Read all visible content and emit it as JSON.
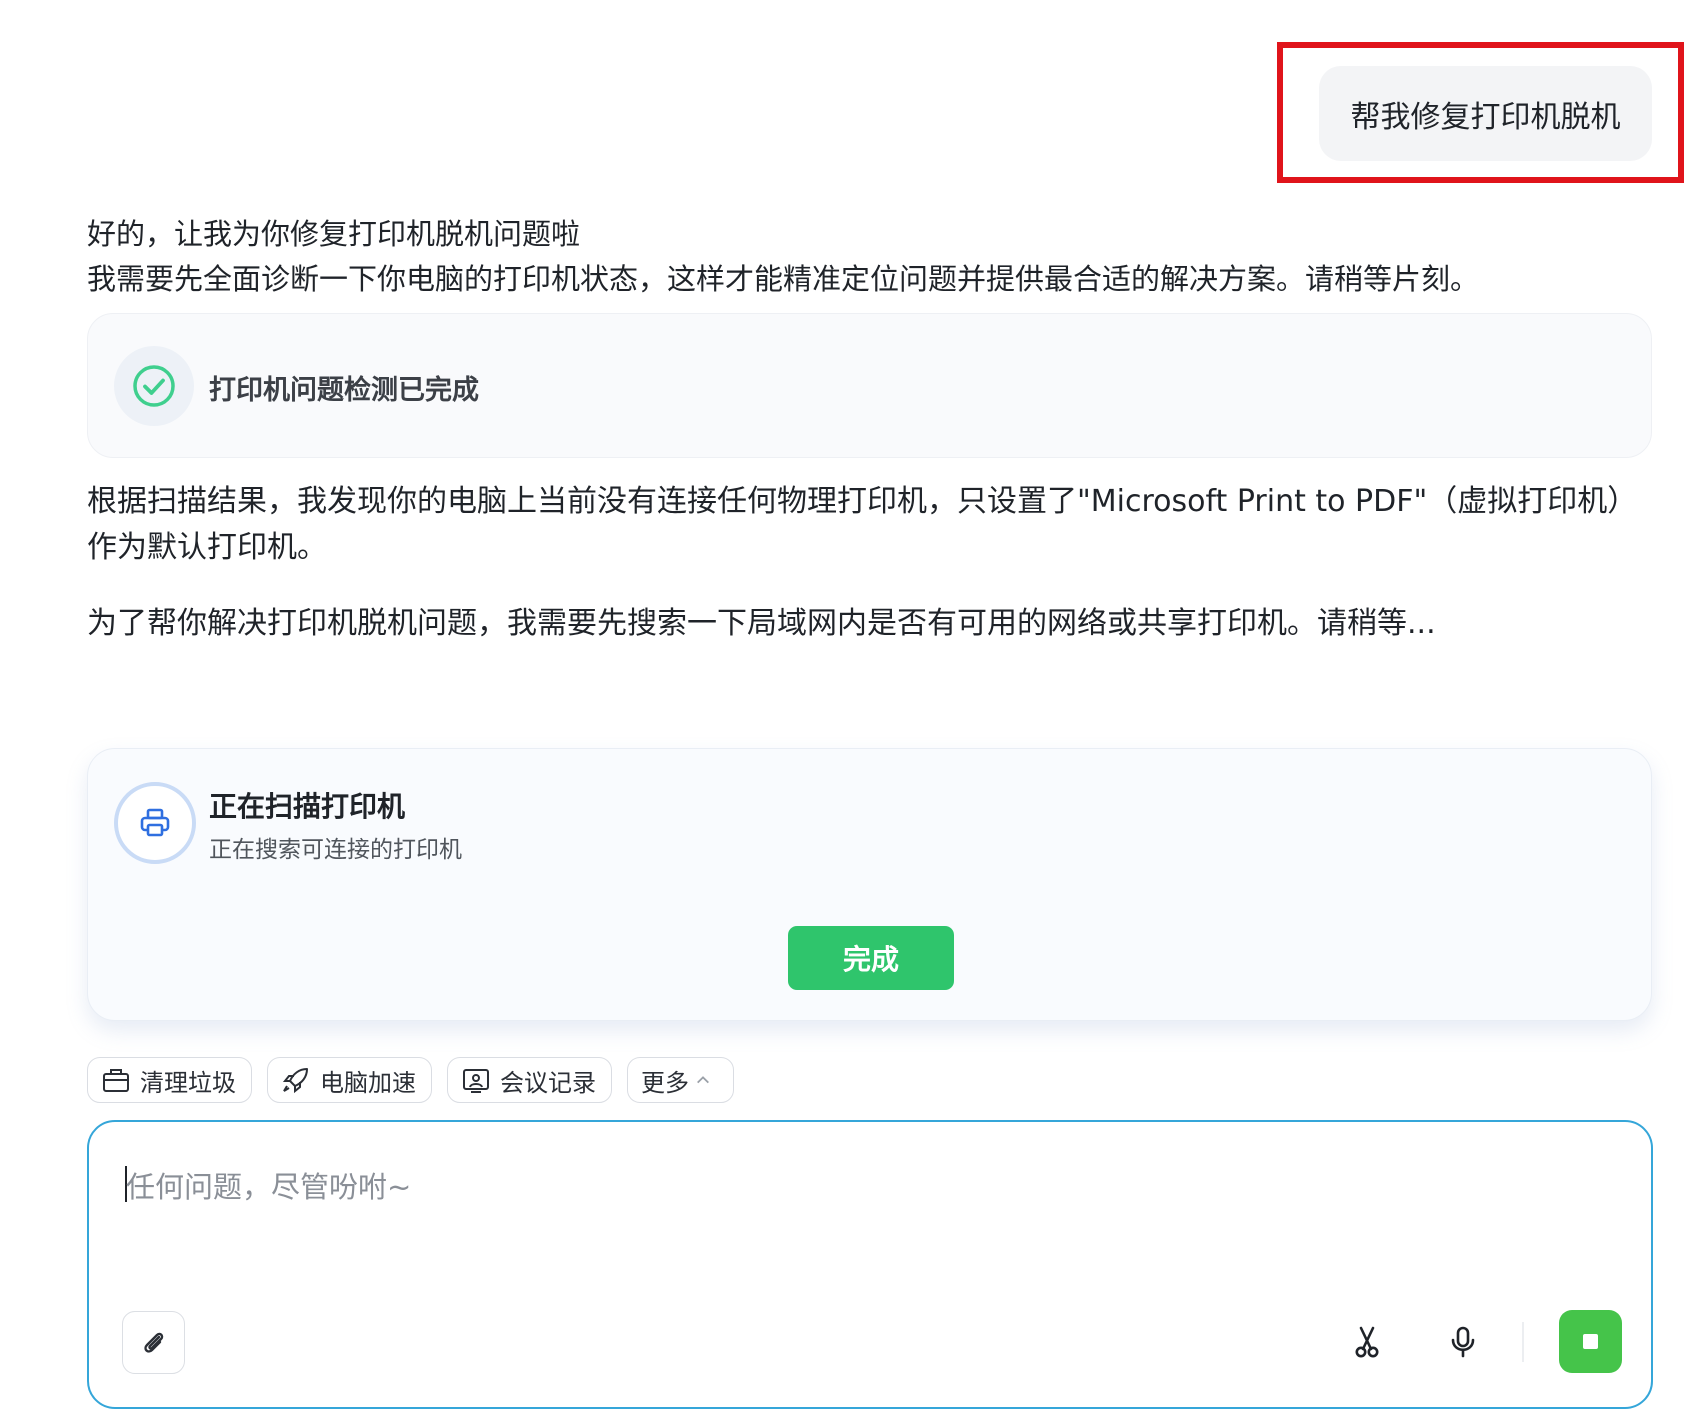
{
  "user_message": "帮我修复打印机脱机",
  "assistant": {
    "line1": "好的，让我为你修复打印机脱机问题啦",
    "line2": "我需要先全面诊断一下你电脑的打印机状态，这样才能精准定位问题并提供最合适的解决方案。请稍等片刻。",
    "detect_card_title": "打印机问题检测已完成",
    "result_para": "根据扫描结果，我发现你的电脑上当前没有连接任何物理打印机，只设置了\"Microsoft Print to PDF\"（虚拟打印机）作为默认打印机。",
    "next_para": "为了帮你解决打印机脱机问题，我需要先搜索一下局域网内是否有可用的网络或共享打印机。请稍等..."
  },
  "scan_card": {
    "title": "正在扫描打印机",
    "subtitle": "正在搜索可连接的打印机",
    "done_label": "完成"
  },
  "quick_actions": [
    {
      "label": "清理垃圾",
      "icon": "briefcase-icon"
    },
    {
      "label": "电脑加速",
      "icon": "rocket-icon"
    },
    {
      "label": "会议记录",
      "icon": "meeting-record-icon"
    },
    {
      "label": "更多",
      "icon": "chevron-up-icon"
    }
  ],
  "input": {
    "placeholder": "任何问题，尽管吩咐~"
  },
  "colors": {
    "highlight": "#e0141b",
    "done_button": "#2fc56c",
    "stop_button": "#45c44a",
    "input_border": "#35a6d9",
    "check": "#3fcf8e",
    "printer_icon": "#2f6fe0"
  }
}
